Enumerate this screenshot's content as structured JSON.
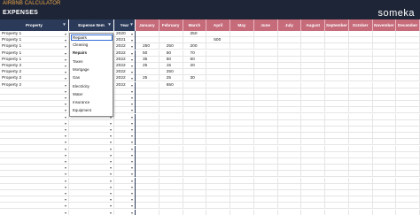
{
  "app": {
    "title": "AIRBNB CALCULATOR"
  },
  "header": {
    "page_title": "EXPENSES",
    "brand": "someka"
  },
  "columns": {
    "property": "Property",
    "expense_item": "Expense Item",
    "year": "Year",
    "months": [
      "January",
      "February",
      "March",
      "April",
      "May",
      "June",
      "July",
      "August",
      "September",
      "October",
      "November",
      "December"
    ]
  },
  "rows": [
    {
      "property": "Property 1",
      "item": "",
      "year": "2020",
      "months": [
        "",
        "",
        "250",
        "",
        "",
        "",
        "",
        "",
        "",
        "",
        "",
        ""
      ]
    },
    {
      "property": "Property 1",
      "item": "",
      "year": "2021",
      "months": [
        "",
        "",
        "",
        "500",
        "",
        "",
        "",
        "",
        "",
        "",
        "",
        ""
      ]
    },
    {
      "property": "Property 1",
      "item": "",
      "year": "2022",
      "months": [
        "250",
        "250",
        "200",
        "",
        "",
        "",
        "",
        "",
        "",
        "",
        "",
        ""
      ]
    },
    {
      "property": "Property 1",
      "item": "",
      "year": "2022",
      "months": [
        "50",
        "50",
        "70",
        "",
        "",
        "",
        "",
        "",
        "",
        "",
        "",
        ""
      ]
    },
    {
      "property": "Property 1",
      "item": "",
      "year": "2022",
      "months": [
        "35",
        "50",
        "60",
        "",
        "",
        "",
        "",
        "",
        "",
        "",
        "",
        ""
      ]
    },
    {
      "property": "Property 2",
      "item": "",
      "year": "2022",
      "months": [
        "25",
        "15",
        "20",
        "",
        "",
        "",
        "",
        "",
        "",
        "",
        "",
        ""
      ]
    },
    {
      "property": "Property 2",
      "item": "",
      "year": "2022",
      "months": [
        "",
        "250",
        "",
        "",
        "",
        "",
        "",
        "",
        "",
        "",
        "",
        ""
      ]
    },
    {
      "property": "Property 2",
      "item": "",
      "year": "2022",
      "months": [
        "25",
        "25",
        "30",
        "",
        "",
        "",
        "",
        "",
        "",
        "",
        "",
        ""
      ]
    },
    {
      "property": "Property 2",
      "item": "",
      "year": "2022",
      "months": [
        "",
        "650",
        "",
        "",
        "",
        "",
        "",
        "",
        "",
        "",
        "",
        ""
      ]
    }
  ],
  "dropdown": {
    "selected": "Repairs",
    "options": [
      "Cleaning",
      "Repairs",
      "Taxes",
      "Mortgage",
      "Gas",
      "Electricity",
      "Water",
      "Insurance",
      "Equipment"
    ]
  },
  "colors": {
    "header_dark": "#1e2536",
    "column_header": "#2b3a59",
    "month_header": "#c66b7a",
    "title_accent": "#f0a848"
  }
}
